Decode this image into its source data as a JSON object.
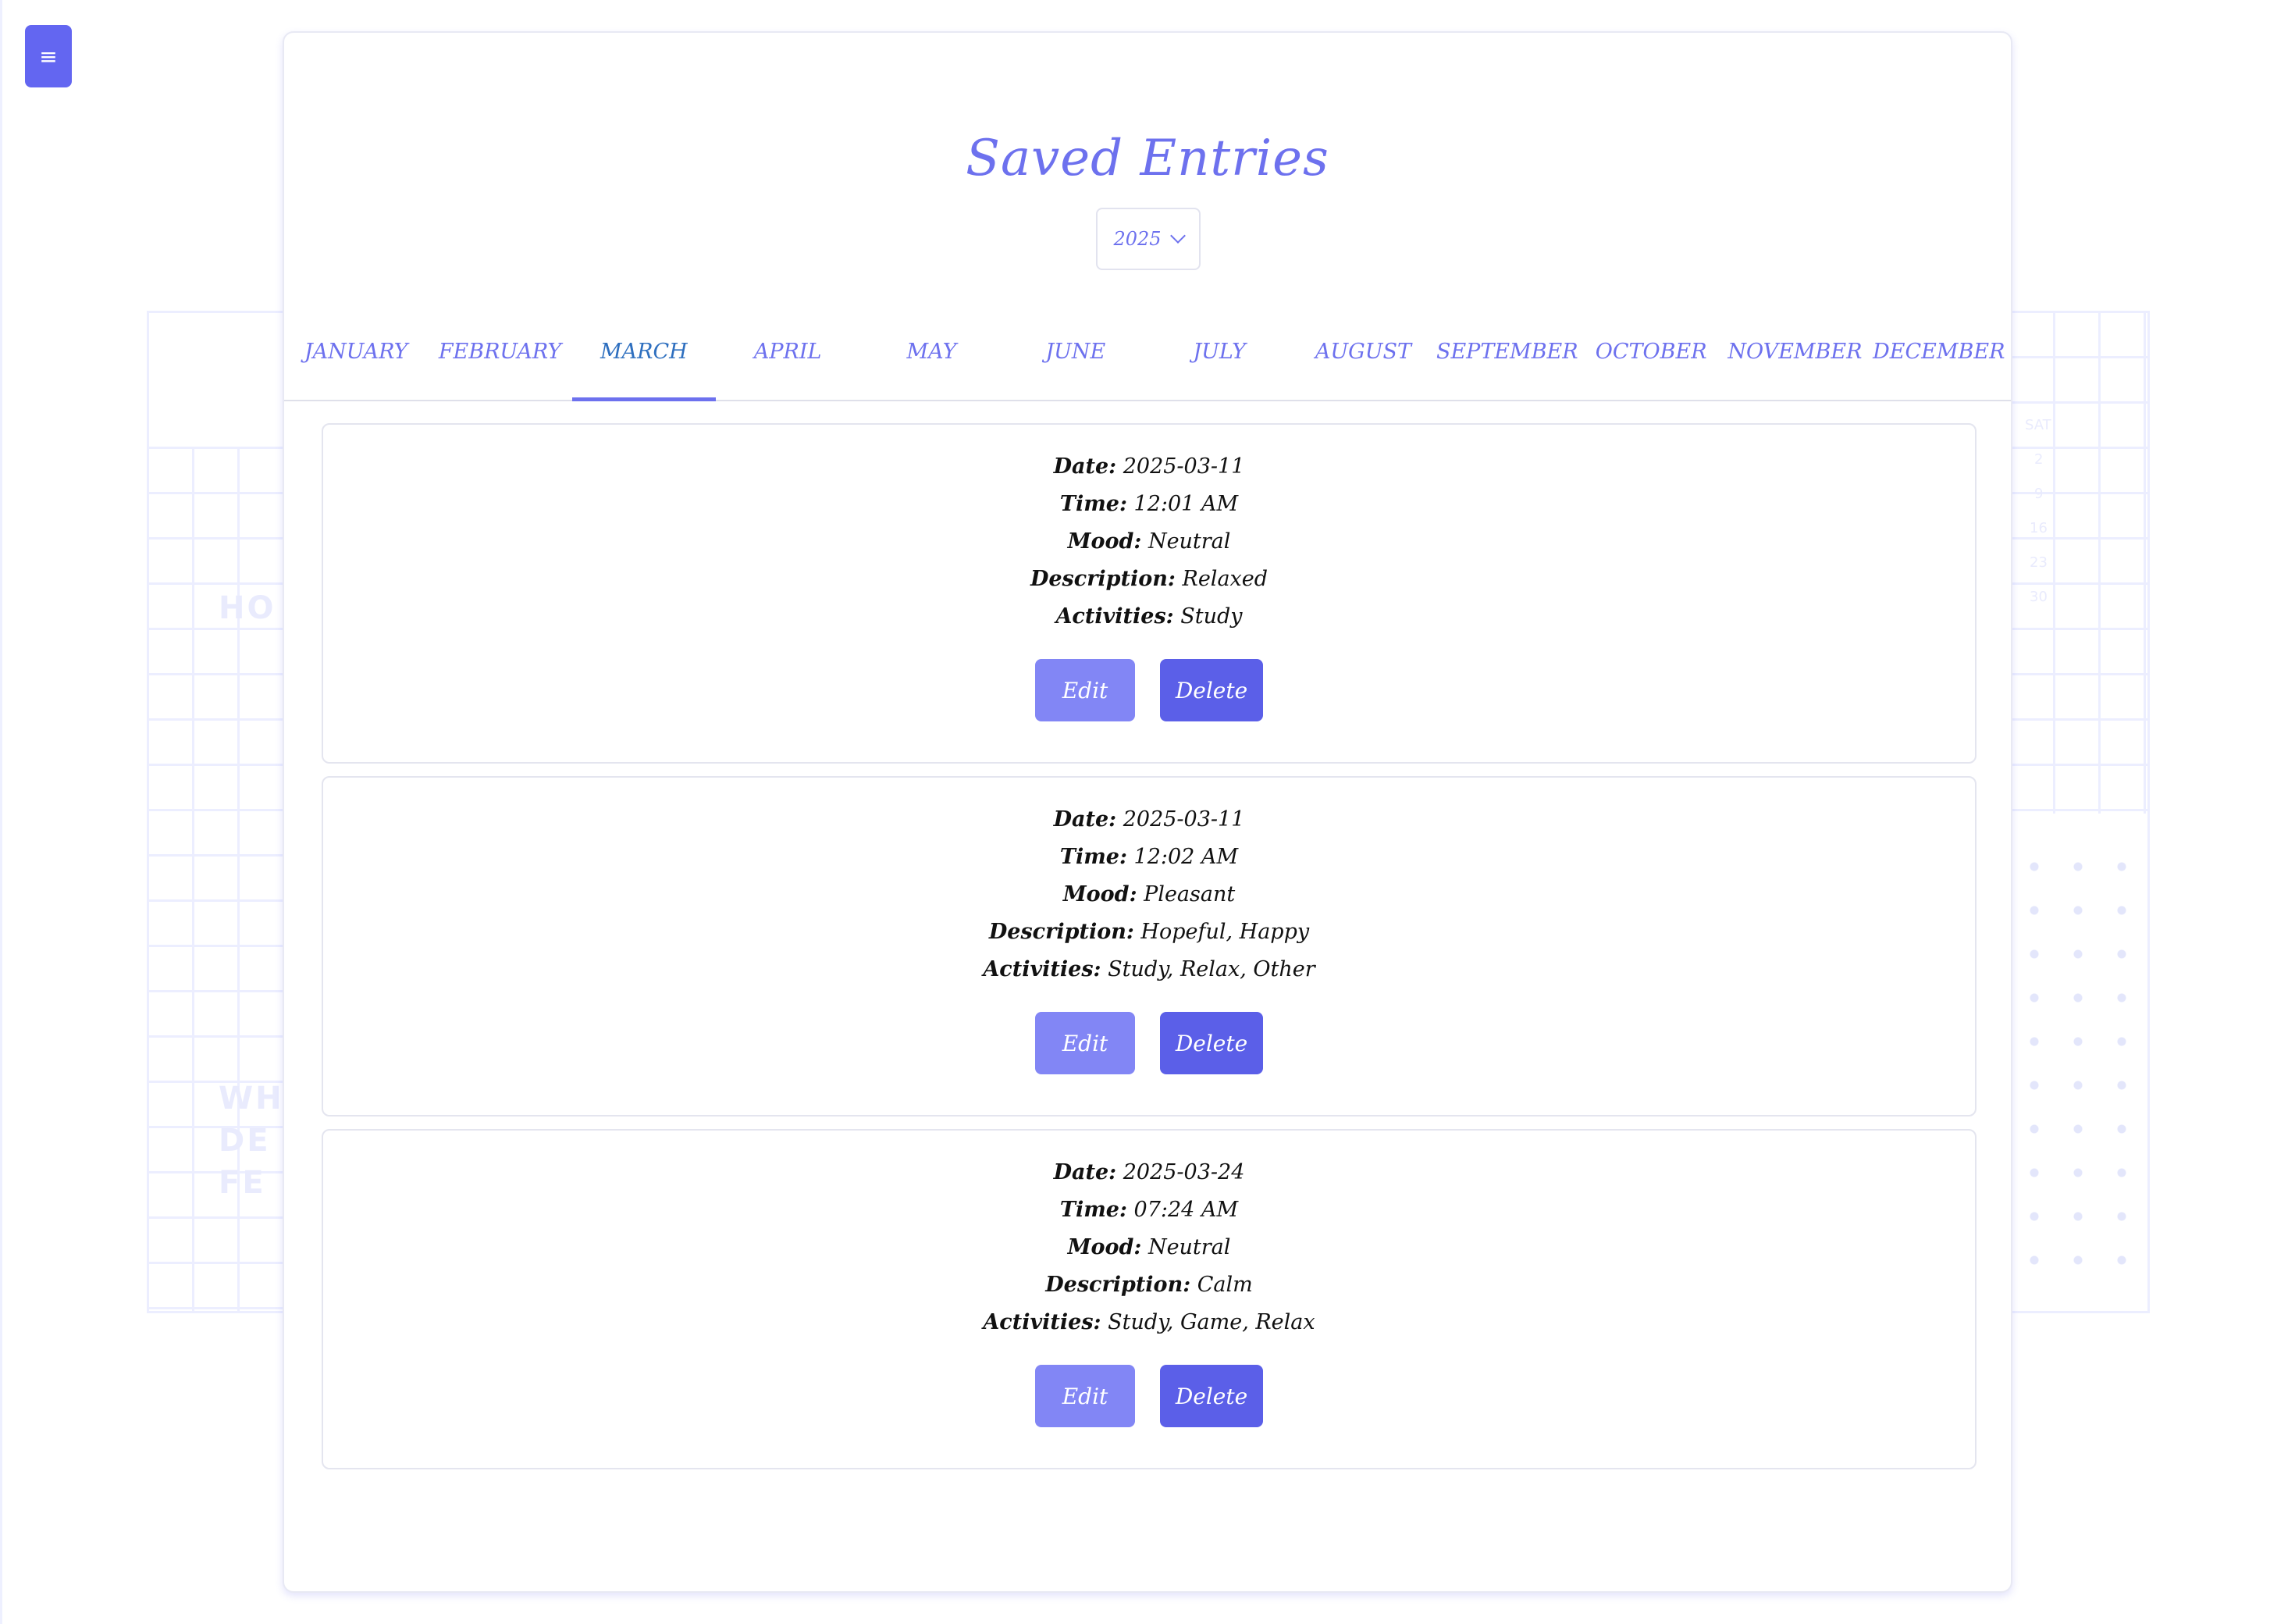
{
  "menu": {
    "icon_glyph": "≡"
  },
  "page": {
    "title": "Saved Entries"
  },
  "year_select": {
    "value": "2025"
  },
  "months": [
    {
      "label": "JANUARY"
    },
    {
      "label": "FEBRUARY"
    },
    {
      "label": "MARCH",
      "active": true
    },
    {
      "label": "APRIL"
    },
    {
      "label": "MAY"
    },
    {
      "label": "JUNE"
    },
    {
      "label": "JULY"
    },
    {
      "label": "AUGUST"
    },
    {
      "label": "SEPTEMBER"
    },
    {
      "label": "OCTOBER"
    },
    {
      "label": "NOVEMBER"
    },
    {
      "label": "DECEMBER"
    }
  ],
  "field_labels": {
    "date": "Date:",
    "time": "Time:",
    "mood": "Mood:",
    "description": "Description:",
    "activities": "Activities:"
  },
  "buttons": {
    "edit": "Edit",
    "delete": "Delete"
  },
  "entries": [
    {
      "date": "2025-03-11",
      "time": "12:01 AM",
      "mood": "Neutral",
      "description": "Relaxed",
      "activities": "Study"
    },
    {
      "date": "2025-03-11",
      "time": "12:02 AM",
      "mood": "Pleasant",
      "description": "Hopeful, Happy",
      "activities": "Study, Relax, Other"
    },
    {
      "date": "2025-03-24",
      "time": "07:24 AM",
      "mood": "Neutral",
      "description": "Calm",
      "activities": "Study, Game, Relax"
    }
  ],
  "background": {
    "words": [
      "HO",
      "WH",
      "DE",
      "FE"
    ],
    "weekday": "SAT",
    "day_numbers": [
      "2",
      "9",
      "16",
      "23",
      "30"
    ]
  },
  "colors": {
    "accent": "#6366f1",
    "edit_button": "#8286f5",
    "delete_button": "#5b5fe8",
    "active_tab": "#2e6fbf"
  }
}
